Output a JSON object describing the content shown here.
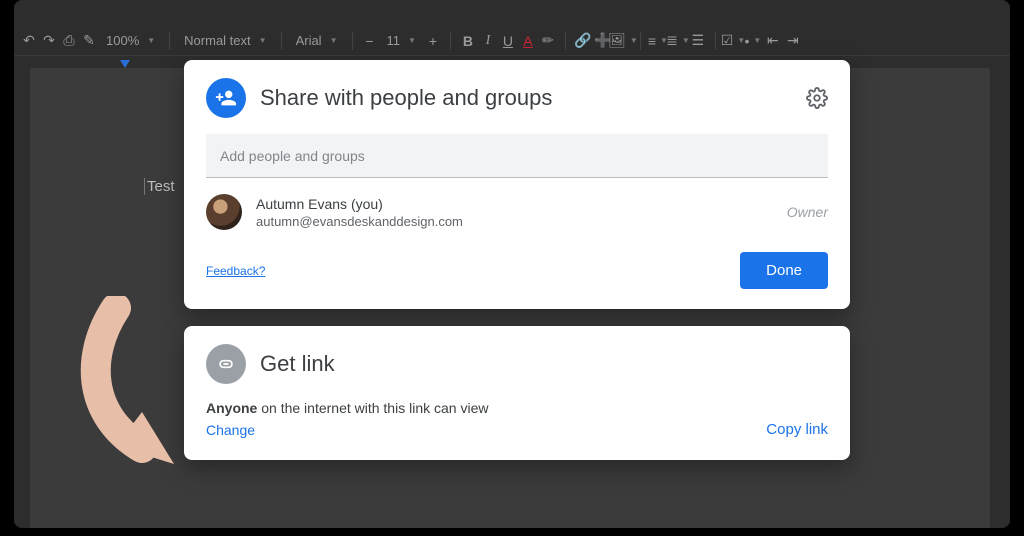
{
  "toolbar": {
    "zoom": "100%",
    "style": "Normal text",
    "font": "Arial",
    "fontSize": "11"
  },
  "doc": {
    "body_text": "Test"
  },
  "share": {
    "title": "Share with people and groups",
    "placeholder": "Add people and groups",
    "owner_name": "Autumn Evans (you)",
    "owner_email": "autumn@evansdeskanddesign.com",
    "owner_role": "Owner",
    "feedback": "Feedback?",
    "done": "Done"
  },
  "getlink": {
    "title": "Get link",
    "desc_bold": "Anyone",
    "desc_rest": " on the internet with this link can view",
    "change": "Change",
    "copy": "Copy link"
  }
}
